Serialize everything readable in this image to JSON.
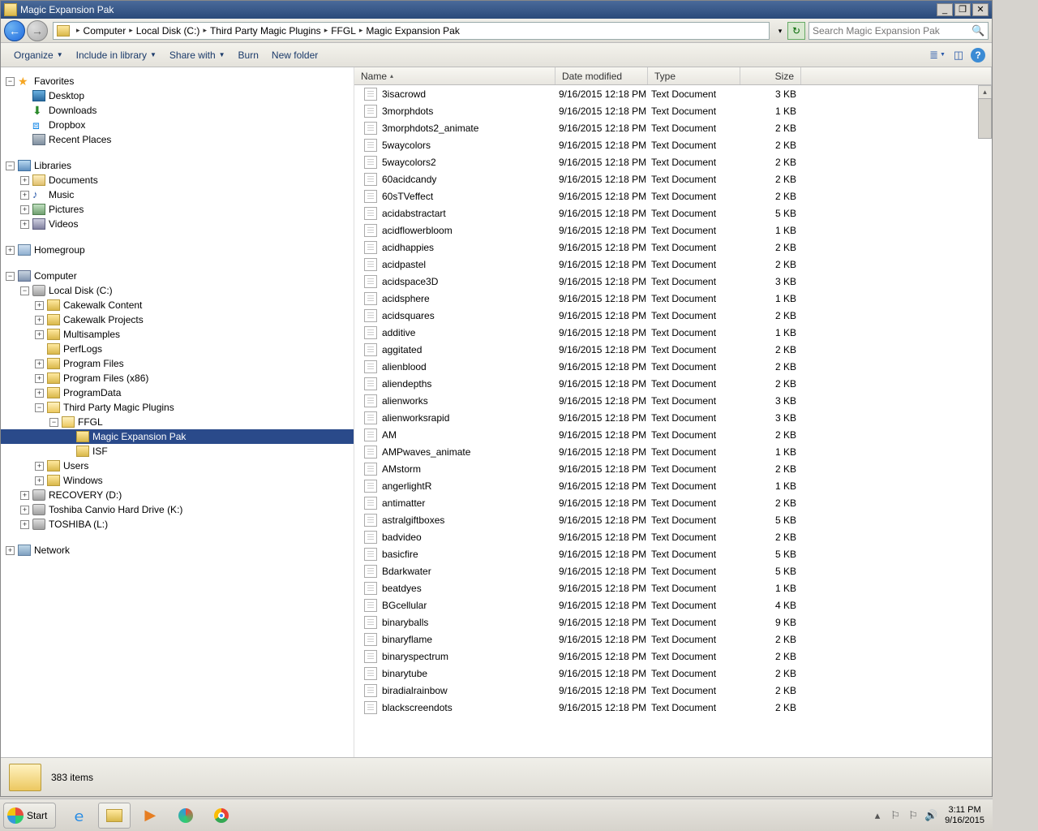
{
  "window_title": "Magic Expansion Pak",
  "breadcrumbs": [
    "Computer",
    "Local Disk (C:)",
    "Third Party Magic Plugins",
    "FFGL",
    "Magic Expansion Pak"
  ],
  "search_placeholder": "Search Magic Expansion Pak",
  "toolbar": {
    "organize": "Organize",
    "include": "Include in library",
    "share": "Share with",
    "burn": "Burn",
    "newfolder": "New folder"
  },
  "nav": {
    "favorites": "Favorites",
    "desktop": "Desktop",
    "downloads": "Downloads",
    "dropbox": "Dropbox",
    "recent": "Recent Places",
    "libraries": "Libraries",
    "documents": "Documents",
    "music": "Music",
    "pictures": "Pictures",
    "videos": "Videos",
    "homegroup": "Homegroup",
    "computer": "Computer",
    "localc": "Local Disk (C:)",
    "cakecontent": "Cakewalk Content",
    "cakeproj": "Cakewalk Projects",
    "multisamples": "Multisamples",
    "perflogs": "PerfLogs",
    "progfiles": "Program Files",
    "progfilesx86": "Program Files (x86)",
    "progdata": "ProgramData",
    "thirdparty": "Third Party Magic Plugins",
    "ffgl": "FFGL",
    "magicexp": "Magic Expansion Pak",
    "isf": "ISF",
    "users": "Users",
    "windows": "Windows",
    "recovery": "RECOVERY (D:)",
    "toshibak": "Toshiba Canvio Hard Drive (K:)",
    "toshibal": "TOSHIBA (L:)",
    "network": "Network"
  },
  "columns": {
    "name": "Name",
    "date": "Date modified",
    "type": "Type",
    "size": "Size"
  },
  "date_val": "9/16/2015 12:18 PM",
  "type_val": "Text Document",
  "files": [
    {
      "n": "3isacrowd",
      "s": "3 KB"
    },
    {
      "n": "3morphdots",
      "s": "1 KB"
    },
    {
      "n": "3morphdots2_animate",
      "s": "2 KB"
    },
    {
      "n": "5waycolors",
      "s": "2 KB"
    },
    {
      "n": "5waycolors2",
      "s": "2 KB"
    },
    {
      "n": "60acidcandy",
      "s": "2 KB"
    },
    {
      "n": "60sTVeffect",
      "s": "2 KB"
    },
    {
      "n": "acidabstractart",
      "s": "5 KB"
    },
    {
      "n": "acidflowerbloom",
      "s": "1 KB"
    },
    {
      "n": "acidhappies",
      "s": "2 KB"
    },
    {
      "n": "acidpastel",
      "s": "2 KB"
    },
    {
      "n": "acidspace3D",
      "s": "3 KB"
    },
    {
      "n": "acidsphere",
      "s": "1 KB"
    },
    {
      "n": "acidsquares",
      "s": "2 KB"
    },
    {
      "n": "additive",
      "s": "1 KB"
    },
    {
      "n": "aggitated",
      "s": "2 KB"
    },
    {
      "n": "alienblood",
      "s": "2 KB"
    },
    {
      "n": "aliendepths",
      "s": "2 KB"
    },
    {
      "n": "alienworks",
      "s": "3 KB"
    },
    {
      "n": "alienworksrapid",
      "s": "3 KB"
    },
    {
      "n": "AM",
      "s": "2 KB"
    },
    {
      "n": "AMPwaves_animate",
      "s": "1 KB"
    },
    {
      "n": "AMstorm",
      "s": "2 KB"
    },
    {
      "n": "angerlightR",
      "s": "1 KB"
    },
    {
      "n": "antimatter",
      "s": "2 KB"
    },
    {
      "n": "astralgiftboxes",
      "s": "5 KB"
    },
    {
      "n": "badvideo",
      "s": "2 KB"
    },
    {
      "n": "basicfire",
      "s": "5 KB"
    },
    {
      "n": "Bdarkwater",
      "s": "5 KB"
    },
    {
      "n": "beatdyes",
      "s": "1 KB"
    },
    {
      "n": "BGcellular",
      "s": "4 KB"
    },
    {
      "n": "binaryballs",
      "s": "9 KB"
    },
    {
      "n": "binaryflame",
      "s": "2 KB"
    },
    {
      "n": "binaryspectrum",
      "s": "2 KB"
    },
    {
      "n": "binarytube",
      "s": "2 KB"
    },
    {
      "n": "biradialrainbow",
      "s": "2 KB"
    },
    {
      "n": "blackscreendots",
      "s": "2 KB"
    }
  ],
  "status_items": "383 items",
  "start_label": "Start",
  "time": "3:11 PM",
  "datestr": "9/16/2015"
}
